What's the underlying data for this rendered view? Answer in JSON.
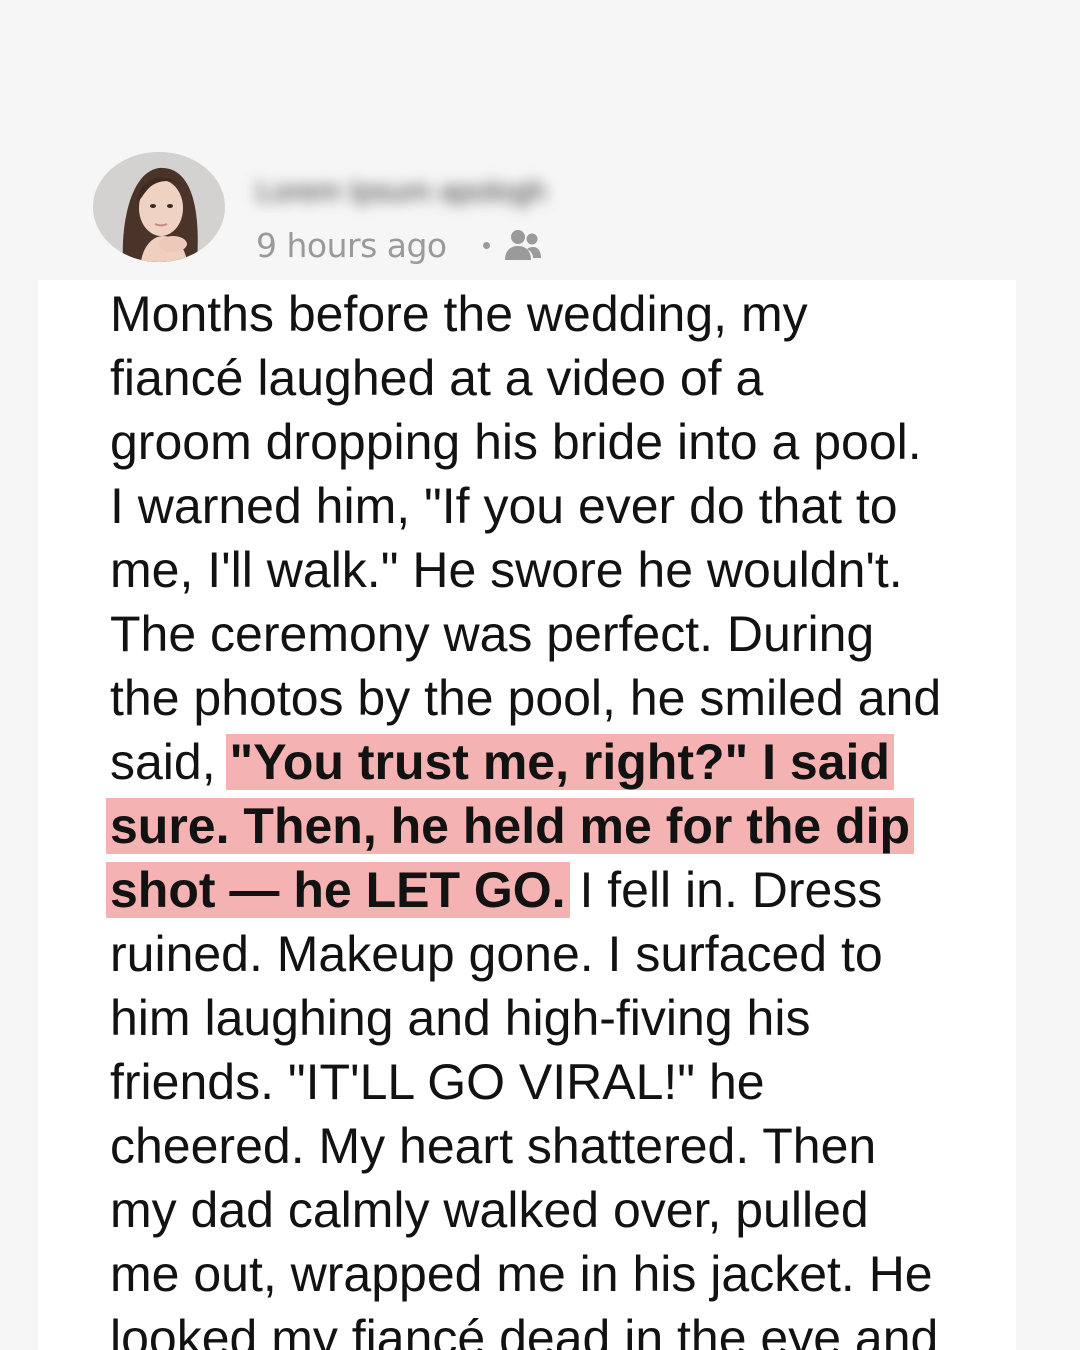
{
  "post": {
    "author": "Lorem Ipsum apologh",
    "timestamp": "9 hours ago",
    "audience_icon": "friends-icon",
    "avatar_icon": "profile-photo"
  },
  "story": {
    "lines": [
      {
        "pre": "Months before the wedding, my"
      },
      {
        "pre": "fiancé laughed at a video of a"
      },
      {
        "pre": "groom dropping his bride into a pool."
      },
      {
        "pre": "I warned him, \"If you ever do that to"
      },
      {
        "pre": "me, I'll walk.\" He swore he wouldn't."
      },
      {
        "pre": "The ceremony was perfect. During"
      },
      {
        "pre": "the photos by the pool, he smiled and"
      },
      {
        "pre": "said, ",
        "hl": "\"You trust me, right?\" I said"
      },
      {
        "hl": "sure. Then, he held me for the dip"
      },
      {
        "hl": "shot  — he LET GO.",
        "post": " I fell in. Dress"
      },
      {
        "pre": "ruined. Makeup gone. I surfaced to"
      },
      {
        "pre": "him laughing and high-fiving his"
      },
      {
        "pre": "friends. \"IT'LL GO VIRAL!\" he"
      },
      {
        "pre": "cheered. My heart shattered. Then"
      },
      {
        "pre": "my dad calmly walked over, pulled"
      },
      {
        "pre": "me out, wrapped me in his jacket. He"
      },
      {
        "pre": "looked my fiancé dead in the eye and"
      }
    ]
  },
  "colors": {
    "page_background": "#f6f6f6",
    "card_background": "#ffffff",
    "highlight": "#f4b2b2",
    "meta_text": "#9a9a9a",
    "body_text": "#121212"
  }
}
